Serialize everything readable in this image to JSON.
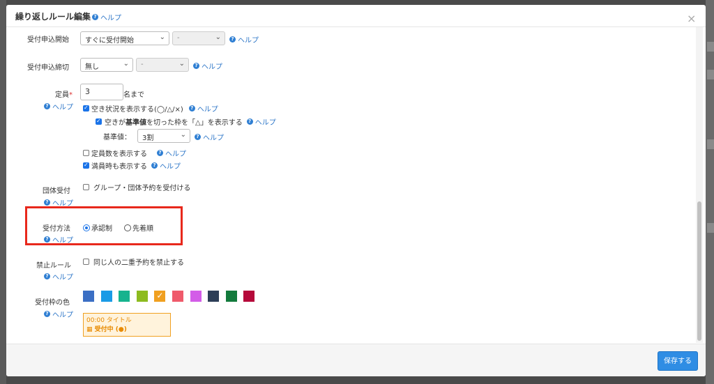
{
  "modal": {
    "title": "繰り返しルール編集",
    "help": "ヘルプ",
    "close": "×"
  },
  "fields": {
    "start": {
      "label": "受付申込開始",
      "select1": "すぐに受付開始",
      "select2": "-",
      "help": "ヘルプ"
    },
    "end": {
      "label": "受付申込締切",
      "select1": "無し",
      "select2": "-",
      "help": "ヘルプ"
    },
    "capacity": {
      "label": "定員",
      "required_mark": "*",
      "help": "ヘルプ",
      "value": "3",
      "suffix": "名まで",
      "show_availability": {
        "label": "空き状況を表示する(◯/△/×)",
        "checked": true,
        "help": "ヘルプ"
      },
      "threshold_toggle": {
        "label_pre": "空きが",
        "label_bold": "基準値",
        "label_post": "を切った枠を「△」を表示する",
        "checked": true,
        "help": "ヘルプ"
      },
      "threshold": {
        "label": "基準値：",
        "value": "3割",
        "help": "ヘルプ"
      },
      "show_count": {
        "label": "定員数を表示する",
        "checked": false,
        "help": "ヘルプ"
      },
      "show_full": {
        "label": "満員時も表示する",
        "checked": true,
        "help": "ヘルプ"
      }
    },
    "group": {
      "label": "団体受付",
      "help": "ヘルプ",
      "option": "グループ・団体予約を受付ける",
      "checked": false
    },
    "method": {
      "label": "受付方法",
      "help": "ヘルプ",
      "options": [
        "承認制",
        "先着順"
      ],
      "selected": "承認制"
    },
    "ban": {
      "label": "禁止ルール",
      "help": "ヘルプ",
      "option": "同じ人の二重予約を禁止する",
      "checked": false
    },
    "color": {
      "label": "受付枠の色",
      "help": "ヘルプ",
      "swatches": [
        "#3b6fc4",
        "#1a9be6",
        "#16b38e",
        "#8dbb1f",
        "#f0a020",
        "#ef5a6b",
        "#d35ce8",
        "#2d3e57",
        "#137a3c",
        "#b5093a"
      ],
      "selected_index": 4,
      "preview_time": "00:00 タイトル",
      "preview_status": "受付中 (●)"
    }
  },
  "footer": {
    "save": "保存する"
  }
}
